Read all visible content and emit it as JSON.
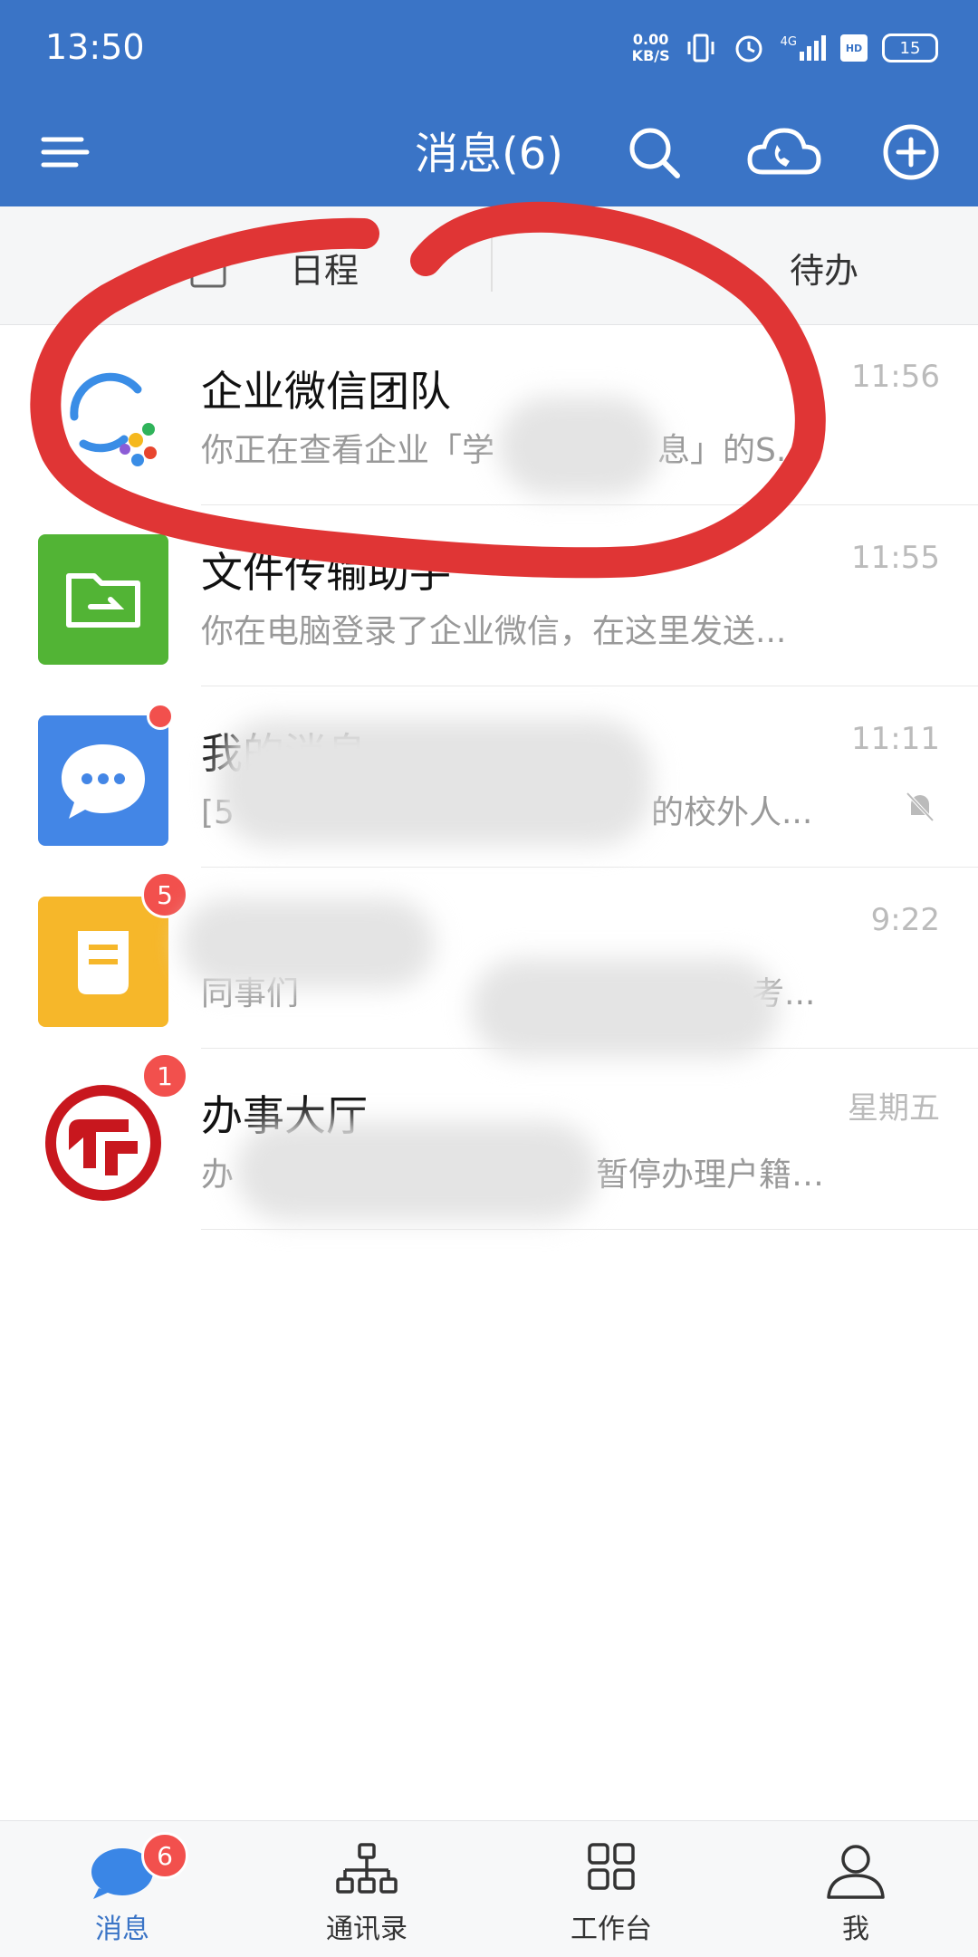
{
  "status": {
    "time": "13:50",
    "speed_value": "0.00",
    "speed_unit": "KB/S",
    "net": "4G",
    "hd": "HD",
    "battery": "15"
  },
  "header": {
    "title": "消息(6)"
  },
  "tabs": {
    "schedule": "日程",
    "todo": "待办"
  },
  "messages": [
    {
      "name": "企业微信团队",
      "preview": "你正在查看企业「学",
      "preview_tail": "息」的S...",
      "time": "11:56"
    },
    {
      "name": "文件传输助手",
      "preview": "你在电脑登录了企业微信，在这里发送...",
      "time": "11:55"
    },
    {
      "name": "我的消息",
      "preview": "[5",
      "preview_tail": "的校外人...",
      "time": "11:11",
      "muted": true,
      "has_dot": true
    },
    {
      "name": "",
      "preview": "同事们",
      "preview_tail": "考...",
      "time": "9:22",
      "badge": "5"
    },
    {
      "name": "办事大厅",
      "preview": "办",
      "preview_tail": "暂停办理户籍业...",
      "time": "星期五",
      "badge": "1"
    }
  ],
  "nav": [
    {
      "label": "消息",
      "badge": "6"
    },
    {
      "label": "通讯录"
    },
    {
      "label": "工作台"
    },
    {
      "label": "我"
    }
  ],
  "colors": {
    "brand": "#3a74c6",
    "badge": "#f2504d",
    "annotation": "#e03535"
  }
}
